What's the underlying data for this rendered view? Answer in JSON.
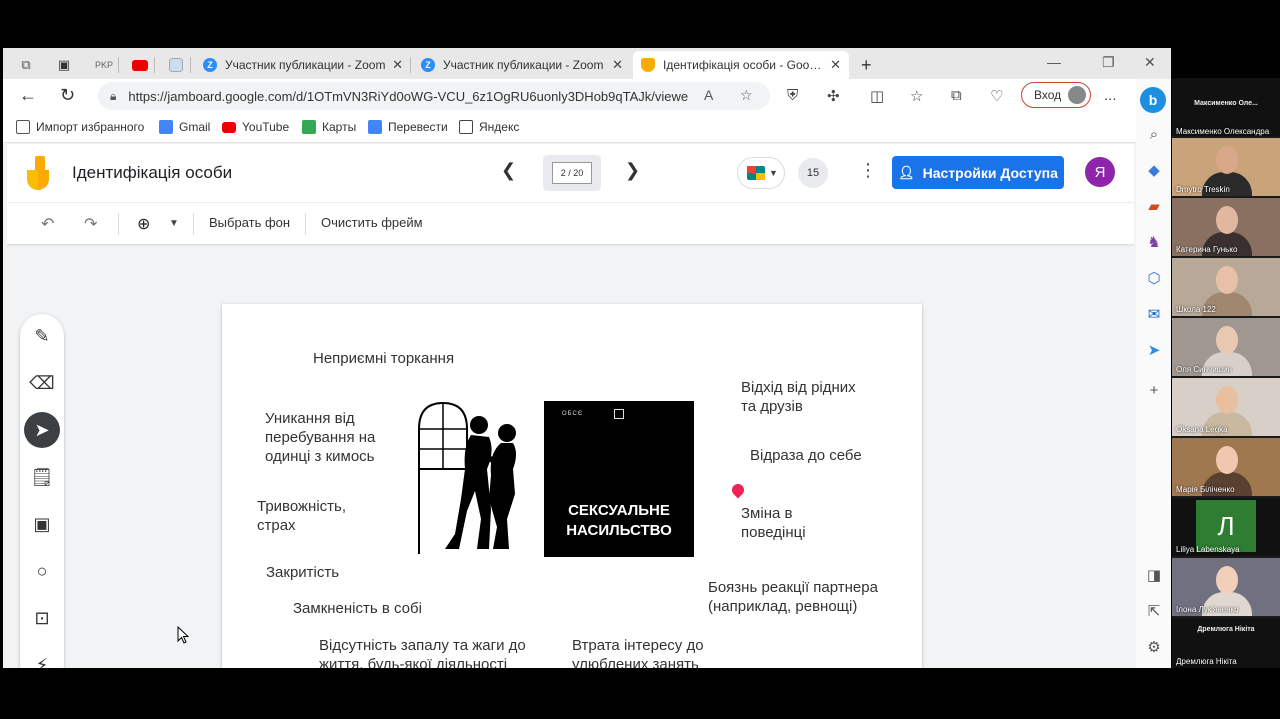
{
  "browser": {
    "tabs": [
      {
        "label": "PKP",
        "kind": "small"
      },
      {
        "label": "",
        "kind": "youtube"
      },
      {
        "label": "",
        "kind": "generic"
      },
      {
        "label": "Участник публикации - Zoom",
        "kind": "zoom"
      },
      {
        "label": "Участник публикации - Zoom",
        "kind": "zoom"
      },
      {
        "label": "Ідентифікація особи - Google Ja",
        "kind": "jamboard",
        "active": true
      }
    ],
    "new_tab": "+",
    "url": "https://jamboard.google.com/d/1OTmVN3RiYd0oWG-VCU_6z1OgRU6uonly3DHob9qTAJk/viewe...",
    "signin_label": "Вход",
    "more_label": "...",
    "favorites": [
      {
        "label": "Импорт избранного",
        "color": "#555555"
      },
      {
        "label": "Gmail",
        "color": "#4285f4"
      },
      {
        "label": "YouTube",
        "color": "#ee0000"
      },
      {
        "label": "Карты",
        "color": "#34a853"
      },
      {
        "label": "Перевести",
        "color": "#4285f4"
      },
      {
        "label": "Яндекс",
        "color": "#444444"
      }
    ]
  },
  "jamboard": {
    "title": "Ідентифікація особи",
    "frame_counter": "2 / 20",
    "participants": "15",
    "share_label": "Настройки Доступа",
    "user_initial": "Я",
    "toolbar": {
      "set_background": "Выбрать фон",
      "clear_frame": "Очистить фрейм"
    },
    "notes": {
      "unpleasant_touch": "Неприємні торкання",
      "avoid_alone": "Уникання від\nперебування на\nодинці з кимось",
      "anxiety": "Тривожність,\nстрах",
      "closedness": "Закритість",
      "withdrawn": "Замкненість в собі",
      "no_zeal": "Відсутність запалу та жаги до\nжиття, будь-якої діяльності",
      "lost_interest": "Втрата інтересу до\nулюблених занять",
      "withdraw_family": "Відхід від рідних\nта друзів",
      "self_disgust": "Відраза до себе",
      "behavior_change": "Зміна в\nповедінці",
      "fear_partner": "Боязнь реакції партнера\n(наприклад, ревнощі)"
    },
    "poster": {
      "title": "СЕКСУАЛЬНЕ\nНАСИЛЬСТВО",
      "logo_text": "ОБСЄ"
    }
  },
  "zoom": {
    "participants": [
      {
        "name": "Максименко Олександра",
        "cam": false,
        "label": "Максименко Оле..."
      },
      {
        "name": "Dmytro Treskin",
        "cam": true,
        "bg": "#c9a47a",
        "face": "#d9a88a",
        "body": "#2b2b2b"
      },
      {
        "name": "Катерина Гунько",
        "cam": true,
        "bg": "#8a7060",
        "face": "#e0b8a0",
        "body": "#3a3030"
      },
      {
        "name": "Школа 122",
        "cam": true,
        "bg": "#b8a898",
        "face": "#e8c0a8",
        "body": "#a08870"
      },
      {
        "name": "Оля Синчишин",
        "cam": true,
        "bg": "#a09890",
        "face": "#e8c8b0",
        "body": "#d8d0c8"
      },
      {
        "name": "Oksana Legka",
        "cam": true,
        "bg": "#d8d0c8",
        "face": "#e8c0a0",
        "body": "#c8b8a0"
      },
      {
        "name": "Марія Біліченко",
        "cam": true,
        "bg": "#a07850",
        "face": "#f0c8b0",
        "body": "#5a4030"
      },
      {
        "name": "Liliya Labenskaya",
        "cam": false,
        "letter": "Л"
      },
      {
        "name": "Ілона Лук'яненко",
        "cam": true,
        "bg": "#707080",
        "face": "#f0d0b8",
        "body": "#e0d8d0"
      },
      {
        "name": "Дремлюга Нікіта",
        "cam": false,
        "label": "Дремлюга Нікіта"
      }
    ]
  },
  "colors": {
    "share_button": "#1a73e8",
    "avatar": "#8e24aa",
    "jamboard_logo": "#f9ab00",
    "poster_bg": "#000000"
  }
}
